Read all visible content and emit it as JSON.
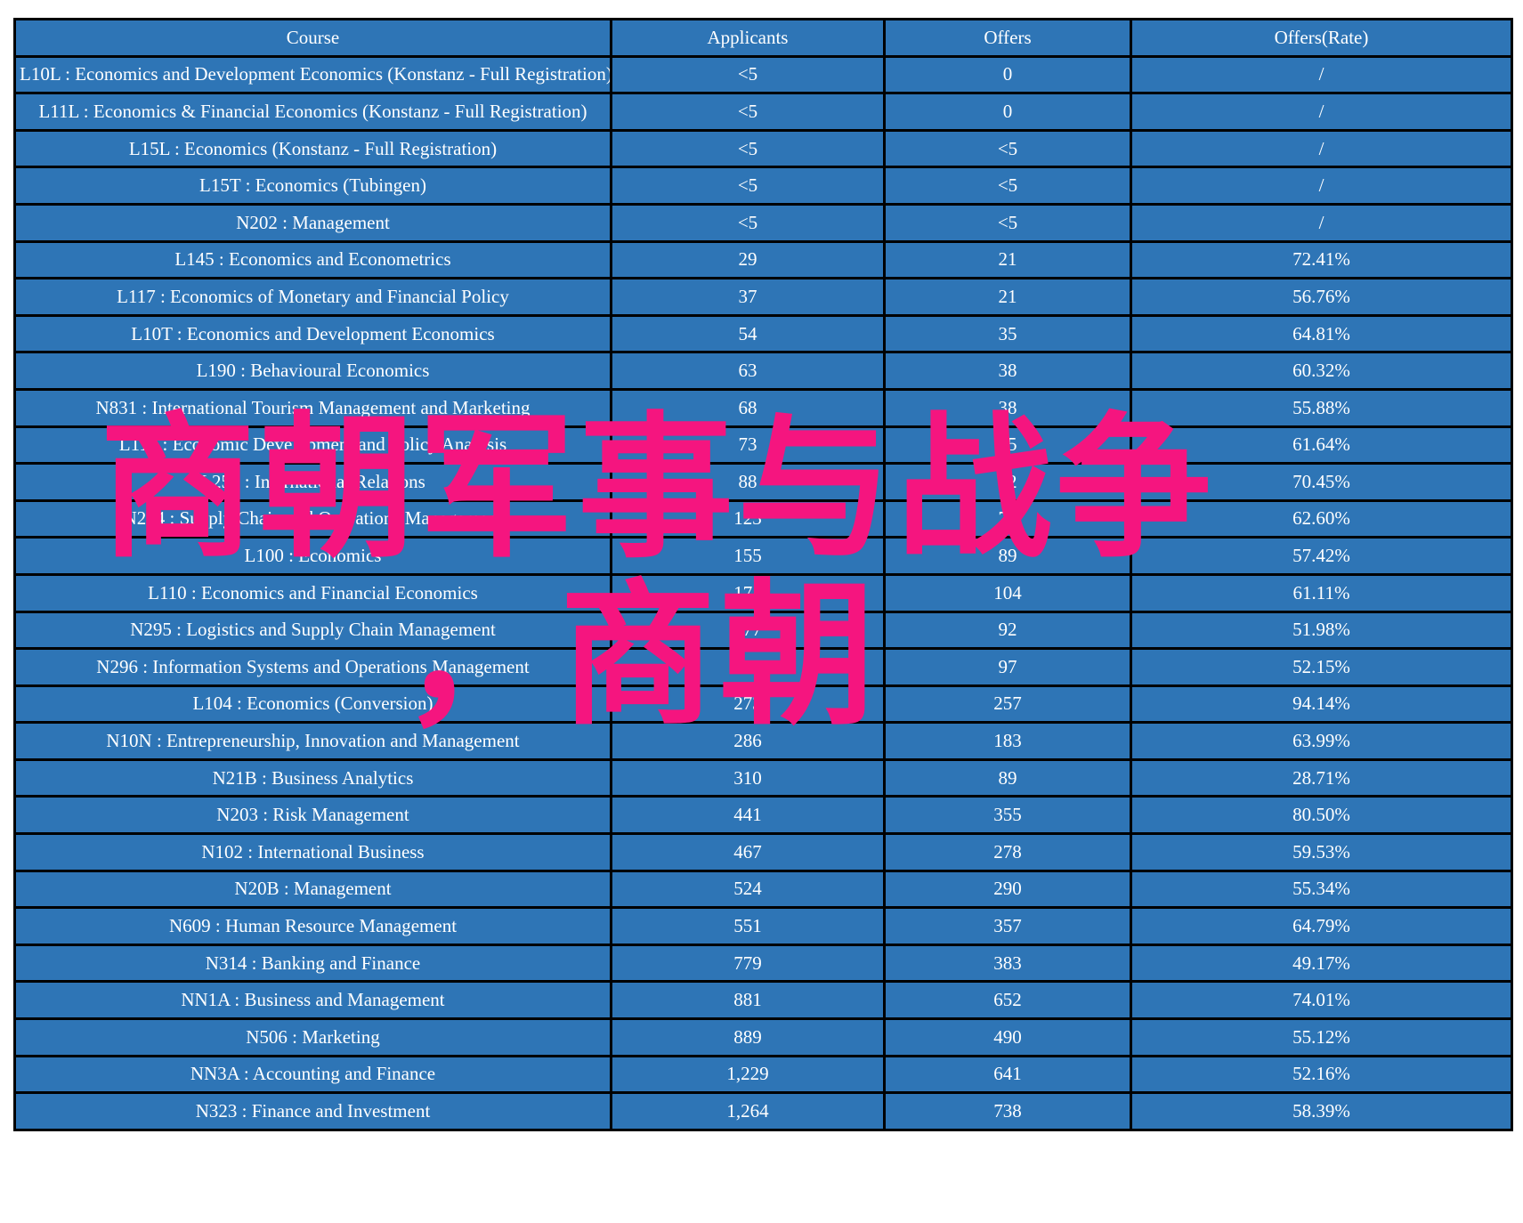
{
  "table": {
    "columns": [
      "Course",
      "Applicants",
      "Offers",
      "Offers(Rate)"
    ],
    "rows": [
      {
        "course": "L10L : Economics and Development Economics (Konstanz - Full Registration)",
        "applicants": "<5",
        "offers": "0",
        "rate": "/",
        "course_color": "white",
        "applicants_color": "white",
        "rate_color": "white"
      },
      {
        "course": "L11L : Economics & Financial Economics (Konstanz - Full Registration)",
        "applicants": "<5",
        "offers": "0",
        "rate": "/",
        "course_color": "white",
        "applicants_color": "white",
        "rate_color": "white"
      },
      {
        "course": "L15L : Economics (Konstanz - Full Registration)",
        "applicants": "<5",
        "offers": "<5",
        "rate": "/",
        "course_color": "white",
        "applicants_color": "white",
        "rate_color": "white"
      },
      {
        "course": "L15T : Economics (Tubingen)",
        "applicants": "<5",
        "offers": "<5",
        "rate": "/",
        "course_color": "white",
        "applicants_color": "white",
        "rate_color": "white"
      },
      {
        "course": "N202 : Management",
        "applicants": "<5",
        "offers": "<5",
        "rate": "/",
        "course_color": "white",
        "applicants_color": "white",
        "rate_color": "white"
      },
      {
        "course": "L145 : Economics and Econometrics",
        "applicants": "29",
        "offers": "21",
        "rate": "72.41%",
        "course_color": "white",
        "applicants_color": "white",
        "rate_color": "red"
      },
      {
        "course": "L117 : Economics of Monetary and Financial Policy",
        "applicants": "37",
        "offers": "21",
        "rate": "56.76%",
        "course_color": "white",
        "applicants_color": "white",
        "rate_color": "white"
      },
      {
        "course": "L10T : Economics and Development Economics",
        "applicants": "54",
        "offers": "35",
        "rate": "64.81%",
        "course_color": "white",
        "applicants_color": "white",
        "rate_color": "white"
      },
      {
        "course": "L190 : Behavioural Economics",
        "applicants": "63",
        "offers": "38",
        "rate": "60.32%",
        "course_color": "white",
        "applicants_color": "white",
        "rate_color": "white"
      },
      {
        "course": "N831 : International Tourism Management and Marketing",
        "applicants": "68",
        "offers": "38",
        "rate": "55.88%",
        "course_color": "white",
        "applicants_color": "white",
        "rate_color": "white"
      },
      {
        "course": "L114 : Economic Development and Policy Analysis",
        "applicants": "73",
        "offers": "45",
        "rate": "61.64%",
        "course_color": "white",
        "applicants_color": "white",
        "rate_color": "white"
      },
      {
        "course": "L250 : International Relations",
        "applicants": "88",
        "offers": "62",
        "rate": "70.45%",
        "course_color": "white",
        "applicants_color": "white",
        "rate_color": "red"
      },
      {
        "course": "N294 : Supply Chain and Operations Management",
        "applicants": "123",
        "offers": "77",
        "rate": "62.60%",
        "course_color": "white",
        "applicants_color": "white",
        "rate_color": "white"
      },
      {
        "course": "L100 : Economics",
        "applicants": "155",
        "offers": "89",
        "rate": "57.42%",
        "course_color": "white",
        "applicants_color": "white",
        "rate_color": "white"
      },
      {
        "course": "L110 : Economics and Financial Economics",
        "applicants": "171",
        "offers": "104",
        "rate": "61.11%",
        "course_color": "white",
        "applicants_color": "white",
        "rate_color": "white"
      },
      {
        "course": "N295 : Logistics and Supply Chain Management",
        "applicants": "177",
        "offers": "92",
        "rate": "51.98%",
        "course_color": "white",
        "applicants_color": "white",
        "rate_color": "white"
      },
      {
        "course": "N296 : Information Systems and Operations Management",
        "applicants": "186",
        "offers": "97",
        "rate": "52.15%",
        "course_color": "white",
        "applicants_color": "white",
        "rate_color": "white"
      },
      {
        "course": "L104 : Economics (Conversion)",
        "applicants": "273",
        "offers": "257",
        "rate": "94.14%",
        "course_color": "white",
        "applicants_color": "white",
        "rate_color": "red"
      },
      {
        "course": "N10N : Entrepreneurship, Innovation and Management",
        "applicants": "286",
        "offers": "183",
        "rate": "63.99%",
        "course_color": "white",
        "applicants_color": "white",
        "rate_color": "white"
      },
      {
        "course": "N21B : Business Analytics",
        "applicants": "310",
        "offers": "89",
        "rate": "28.71%",
        "course_color": "white",
        "applicants_color": "white",
        "rate_color": "white"
      },
      {
        "course": "N203 : Risk Management",
        "applicants": "441",
        "offers": "355",
        "rate": "80.50%",
        "course_color": "white",
        "applicants_color": "white",
        "rate_color": "red"
      },
      {
        "course": "N102 : International Business",
        "applicants": "467",
        "offers": "278",
        "rate": "59.53%",
        "course_color": "white",
        "applicants_color": "white",
        "rate_color": "white"
      },
      {
        "course": "N20B : Management",
        "applicants": "524",
        "offers": "290",
        "rate": "55.34%",
        "course_color": "yellow",
        "applicants_color": "yellow",
        "rate_color": "white"
      },
      {
        "course": "N609 : Human Resource Management",
        "applicants": "551",
        "offers": "357",
        "rate": "64.79%",
        "course_color": "yellow",
        "applicants_color": "yellow",
        "rate_color": "white"
      },
      {
        "course": "N314 : Banking and Finance",
        "applicants": "779",
        "offers": "383",
        "rate": "49.17%",
        "course_color": "yellow",
        "applicants_color": "yellow",
        "rate_color": "white"
      },
      {
        "course": "NN1A : Business and Management",
        "applicants": "881",
        "offers": "652",
        "rate": "74.01%",
        "course_color": "yellow",
        "applicants_color": "yellow",
        "rate_color": "red"
      },
      {
        "course": "N506 : Marketing",
        "applicants": "889",
        "offers": "490",
        "rate": "55.12%",
        "course_color": "yellow",
        "applicants_color": "yellow",
        "rate_color": "white"
      },
      {
        "course": "NN3A : Accounting and Finance",
        "applicants": "1,229",
        "offers": "641",
        "rate": "52.16%",
        "course_color": "yellow",
        "applicants_color": "yellow",
        "rate_color": "white"
      },
      {
        "course": "N323 : Finance and Investment",
        "applicants": "1,264",
        "offers": "738",
        "rate": "58.39%",
        "course_color": "yellow",
        "applicants_color": "yellow",
        "rate_color": "white"
      }
    ]
  },
  "watermark": {
    "line1": "商朝军事与战争",
    "line2": "，商朝",
    "color": "#F5157F"
  },
  "colors": {
    "cell_background": "#2E75B6",
    "border": "#000000",
    "text_default": "#FFFFFF",
    "text_highlight": "#FFFF00",
    "text_alert": "#FF0000"
  }
}
